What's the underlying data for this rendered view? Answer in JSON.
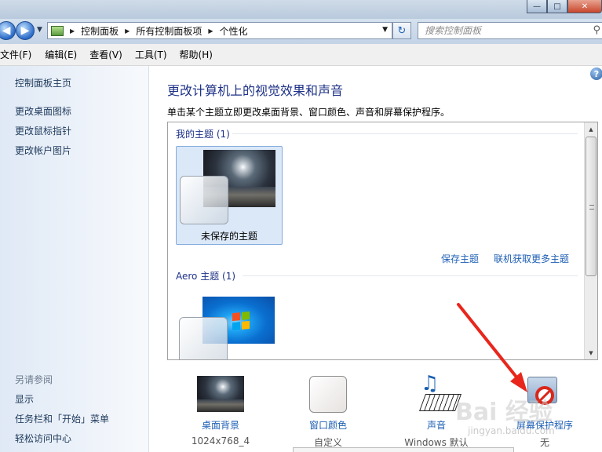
{
  "titlebar": {
    "minimize": "—",
    "maximize": "□",
    "close": "✕"
  },
  "address": {
    "crumbs": [
      "控制面板",
      "所有控制面板项",
      "个性化"
    ],
    "search_placeholder": "搜索控制面板"
  },
  "menu": [
    "文件(F)",
    "编辑(E)",
    "查看(V)",
    "工具(T)",
    "帮助(H)"
  ],
  "sidebar": {
    "home": "控制面板主页",
    "links": [
      "更改桌面图标",
      "更改鼠标指针",
      "更改帐户图片"
    ],
    "see_also_title": "另请参阅",
    "see_also": [
      "显示",
      "任务栏和「开始」菜单",
      "轻松访问中心"
    ]
  },
  "main": {
    "title": "更改计算机上的视觉效果和声音",
    "subtitle": "单击某个主题立即更改桌面背景、窗口颜色、声音和屏幕保护程序。",
    "my_themes": {
      "header": "我的主题 (1)",
      "items": [
        {
          "name": "未保存的主题",
          "selected": true
        }
      ],
      "save_link": "保存主题",
      "online_link": "联机获取更多主题"
    },
    "aero_themes": {
      "header": "Aero 主题 (1)"
    }
  },
  "bottom": [
    {
      "label": "桌面背景",
      "value": "1024x768_4"
    },
    {
      "label": "窗口颜色",
      "value": "自定义"
    },
    {
      "label": "声音",
      "value": "Windows 默认"
    },
    {
      "label": "屏幕保护程序",
      "value": "无"
    }
  ],
  "watermark": {
    "text": "Bai 经验",
    "sub": "jingyan.baidu.com"
  },
  "colors": {
    "link": "#1e5fb4",
    "title": "#1e3287",
    "arrow": "#e8261c"
  }
}
